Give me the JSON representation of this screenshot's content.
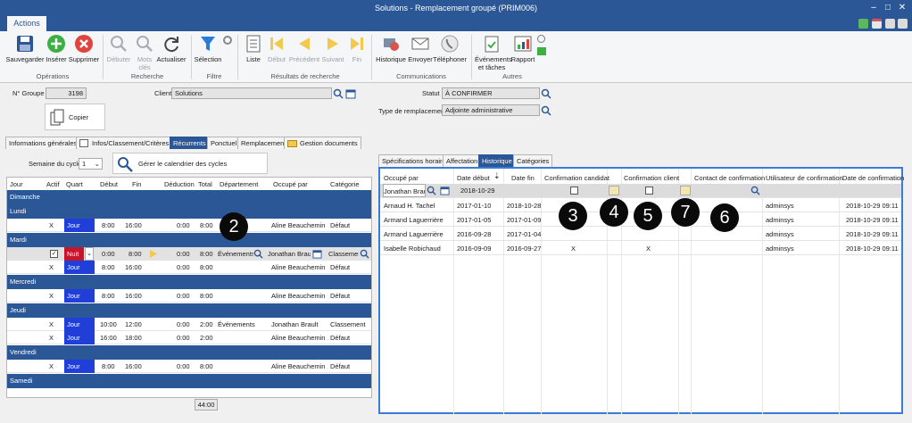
{
  "window": {
    "title": "Solutions - Remplacement groupé (PRIM006)"
  },
  "menu": {
    "actions_tab": "Actions"
  },
  "ribbon": {
    "buttons": {
      "save": "Sauvegarder",
      "insert": "Insérer",
      "delete": "Supprimer",
      "start": "Débuter",
      "keywords_1": "Mots",
      "keywords_2": "clés",
      "refresh": "Actualiser",
      "selection": "Sélection",
      "list": "Liste",
      "begin": "Début",
      "previous": "Précédent",
      "next": "Suivant",
      "end": "Fin",
      "history": "Historique",
      "send": "Envoyer",
      "phone": "Téléphoner",
      "events_1": "Événements",
      "events_2": "et tâches",
      "report": "Rapport"
    },
    "groups": {
      "operations": "Opérations",
      "search": "Recherche",
      "filter": "Filtre",
      "search_results": "Résultats de recherche",
      "communications": "Communications",
      "others": "Autres"
    }
  },
  "form": {
    "group_no_label": "N° Groupe",
    "group_no_value": "3198",
    "copy_button": "Copier",
    "client_label": "Client",
    "client_value": "Solutions",
    "status_label": "Statut",
    "status_value": "À CONFIRMER",
    "replacement_type_label": "Type de remplacement",
    "replacement_type_value": "Adjointe administrative"
  },
  "left_tabs": [
    "Informations générales",
    "Infos/Classement/Critères",
    "Récurrents",
    "Ponctuel",
    "Remplacements",
    "Gestion documents"
  ],
  "cycle": {
    "week_label": "Semaine du cycle",
    "week_value": "1",
    "calendar_button": "Gérer le calendrier des cycles"
  },
  "left_grid": {
    "headers": [
      "Jour",
      "Actif",
      "Quart",
      "Début",
      "Fin",
      "Déduction",
      "Total",
      "Département",
      "Occupé par",
      "Catégorie"
    ],
    "days": {
      "sunday": "Dimanche",
      "monday": "Lundi",
      "tuesday": "Mardi",
      "wednesday": "Mercredi",
      "thursday": "Jeudi",
      "friday": "Vendredi",
      "saturday": "Samedi"
    },
    "rows": {
      "mon1": {
        "actif": "X",
        "quart": "Jour",
        "debut": "8:00",
        "fin": "16:00",
        "deduction": "0:00",
        "total": "8:00",
        "departement": "",
        "occupe": "Aline Beauchemin",
        "categorie": "Défaut"
      },
      "tue_edit": {
        "quart": "Nuit",
        "debut": "0:00",
        "fin": "8:00",
        "deduction": "0:00",
        "total": "8:00",
        "departement": "Événements",
        "occupe": "Jonathan Brault",
        "categorie": "Classemer"
      },
      "tue2": {
        "actif": "X",
        "quart": "Jour",
        "debut": "8:00",
        "fin": "16:00",
        "deduction": "0:00",
        "total": "8:00",
        "departement": "",
        "occupe": "Aline Beauchemin",
        "categorie": "Défaut"
      },
      "wed1": {
        "actif": "X",
        "quart": "Jour",
        "debut": "8:00",
        "fin": "16:00",
        "deduction": "0:00",
        "total": "8:00",
        "departement": "",
        "occupe": "Aline Beauchemin",
        "categorie": "Défaut"
      },
      "thu1": {
        "actif": "X",
        "quart": "Jour",
        "debut": "10:00",
        "fin": "12:00",
        "deduction": "0:00",
        "total": "2:00",
        "departement": "Événements",
        "occupe": "Jonathan Brault",
        "categorie": "Classement"
      },
      "thu2": {
        "actif": "X",
        "quart": "Jour",
        "debut": "16:00",
        "fin": "18:00",
        "deduction": "0:00",
        "total": "2:00",
        "departement": "",
        "occupe": "Aline Beauchemin",
        "categorie": "Défaut"
      },
      "fri1": {
        "actif": "X",
        "quart": "Jour",
        "debut": "8:00",
        "fin": "16:00",
        "deduction": "0:00",
        "total": "8:00",
        "departement": "",
        "occupe": "Aline Beauchemin",
        "categorie": "Défaut"
      }
    },
    "total_hours": "44:00"
  },
  "right_tabs": [
    "Spécifications horaire",
    "Affectation",
    "Historique",
    "Catégories"
  ],
  "history_grid": {
    "headers": [
      "Occupé par",
      "Date début",
      "Date fin",
      "Confirmation candidat",
      "Confirmation client",
      "Contact de confirmation",
      "Utilisateur de confirmation",
      "Date de confirmation"
    ],
    "filter": {
      "occupe": "Jonathan Braul",
      "date_debut": "2018-10-29"
    },
    "rows": [
      {
        "occupe": "Arnaud H. Tachel",
        "debut": "2017-01-10",
        "fin": "2018-10-28",
        "cand": "",
        "client": "",
        "contact": "",
        "user": "adminsys",
        "date_conf": "2018-10-29 09:11"
      },
      {
        "occupe": "Armand Laguerrière",
        "debut": "2017-01-05",
        "fin": "2017-01-09",
        "cand": "",
        "client": "",
        "contact": "",
        "user": "adminsys",
        "date_conf": "2018-10-29 09:11"
      },
      {
        "occupe": "Armand Laguerrière",
        "debut": "2016-09-28",
        "fin": "2017-01-04",
        "cand": "",
        "client": "",
        "contact": "",
        "user": "adminsys",
        "date_conf": "2018-10-29 09:11"
      },
      {
        "occupe": "Isabelle Robichaud",
        "debut": "2016-09-09",
        "fin": "2016-09-27",
        "cand": "X",
        "client": "X",
        "contact": "",
        "user": "adminsys",
        "date_conf": "2018-10-29 09:11"
      }
    ]
  },
  "callouts": {
    "c2": "2",
    "c3": "3",
    "c4": "4",
    "c5": "5",
    "c6": "6",
    "c7": "7"
  },
  "colors": {
    "accent": "#2b5797",
    "jour": "#1f3fd8",
    "nuit": "#c7162b",
    "callout": "#0a0a0a"
  }
}
